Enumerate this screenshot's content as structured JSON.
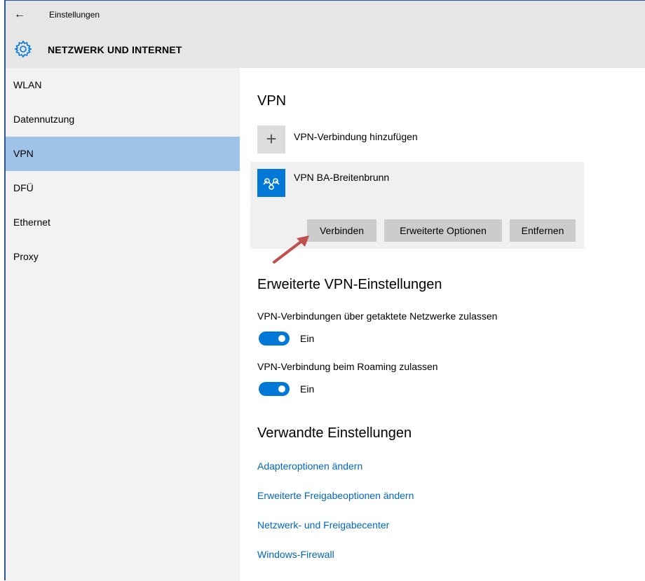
{
  "window": {
    "title": "Einstellungen",
    "back_icon": "back-arrow-icon"
  },
  "header": {
    "title": "NETZWERK UND INTERNET",
    "icon": "gear-icon"
  },
  "sidebar": {
    "items": [
      {
        "label": "WLAN",
        "selected": false
      },
      {
        "label": "Datennutzung",
        "selected": false
      },
      {
        "label": "VPN",
        "selected": true
      },
      {
        "label": "DFÜ",
        "selected": false
      },
      {
        "label": "Ethernet",
        "selected": false
      },
      {
        "label": "Proxy",
        "selected": false
      }
    ]
  },
  "main": {
    "title": "VPN",
    "add_connection": {
      "icon": "plus-icon",
      "label": "VPN-Verbindung hinzufügen"
    },
    "connection": {
      "icon": "vpn-icon",
      "name": "VPN BA-Breitenbrunn",
      "buttons": {
        "connect": "Verbinden",
        "advanced": "Erweiterte Optionen",
        "remove": "Entfernen"
      }
    },
    "advanced_title": "Erweiterte VPN-Einstellungen",
    "settings": [
      {
        "label": "VPN-Verbindungen über getaktete Netzwerke zulassen",
        "state": "Ein",
        "on": true
      },
      {
        "label": "VPN-Verbindung beim Roaming zulassen",
        "state": "Ein",
        "on": true
      }
    ],
    "related_title": "Verwandte Einstellungen",
    "links": [
      "Adapteroptionen ändern",
      "Erweiterte Freigabeoptionen ändern",
      "Netzwerk- und Freigabecenter",
      "Windows-Firewall"
    ]
  },
  "colors": {
    "accent": "#0078d7",
    "selected_nav": "#9ec3e6",
    "link": "#0067c0",
    "annotation_arrow": "#c0504d"
  }
}
